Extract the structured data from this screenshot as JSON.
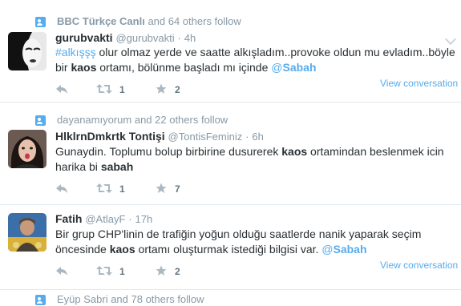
{
  "tweets": [
    {
      "context_name": "BBC Türkçe Canlı",
      "context_rest": "and 64 others follow",
      "fullname": "gurubvakti",
      "username": "@gurubvakti",
      "dot": "·",
      "time": "4h",
      "text_parts": {
        "hashtag": "#alkışşş",
        "p1": " olur olmaz yerde ve saatte alkışladım..provoke oldun mu evladım..böyle bir ",
        "kw": "kaos",
        "p2": " ortamı, bölünme başladı mı içinde ",
        "mention_at": "@",
        "mention_name": "Sabah"
      },
      "view_conversation": "View conversation",
      "retweets": "1",
      "favorites": "2"
    },
    {
      "context_name": "dayanamıyorum",
      "context_rest": "and 22 others follow",
      "fullname": "HlklrnDmkrtk Tontişi",
      "username": "@TontisFeminiz",
      "dot": "·",
      "time": "6h",
      "text_parts": {
        "p1": "Gunaydin. Toplumu bolup birbirine dusurerek ",
        "kw": "kaos",
        "p2": " ortamindan beslenmek icin harika bi ",
        "kw2": "sabah"
      },
      "retweets": "1",
      "favorites": "7"
    },
    {
      "fullname": "Fatih",
      "username": "@AtlayF",
      "dot": "·",
      "time": "17h",
      "text_parts": {
        "p1": "Bir grup CHP'linin de trafiğin yoğun olduğu saatlerde nanik yaparak seçim öncesinde ",
        "kw": "kaos",
        "p2": " ortamı oluşturmak istediği bilgisi var. ",
        "mention_at": "@",
        "mention_name": "Sabah"
      },
      "view_conversation": "View conversation",
      "retweets": "1",
      "favorites": "2"
    }
  ],
  "partial_context": "Eyüp Sabri and 78 others follow",
  "icons": {
    "follow_context": "person-icon",
    "reply": "reply-icon",
    "retweet": "retweet-icon",
    "favorite": "star-icon",
    "more": "more-options-caret-icon"
  },
  "colors": {
    "link": "#55acee",
    "muted": "#8899a6",
    "text": "#292f33",
    "border": "#e1e8ed"
  }
}
